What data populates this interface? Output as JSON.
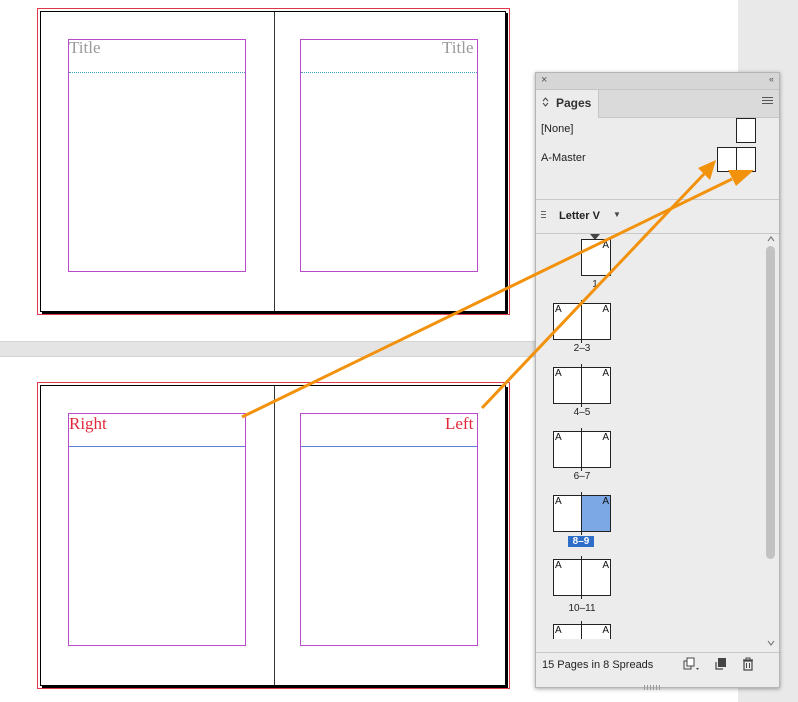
{
  "canvas": {
    "top_spread": {
      "left_title": "Title",
      "right_title": "Title"
    },
    "bottom_spread": {
      "left_label": "Right",
      "right_label": "Left"
    }
  },
  "pages_panel": {
    "close_glyph": "×",
    "collapse_glyph": "‹‹",
    "tab_label": "Pages",
    "tab_arrows": "⌃⌄",
    "masters": [
      {
        "label": "[None]"
      },
      {
        "label": "A-Master"
      }
    ],
    "page_size": "Letter V",
    "caret": "▼",
    "spreads": [
      {
        "number": "1",
        "left": "",
        "right": "A",
        "single": true,
        "selected": false
      },
      {
        "number": "2–3",
        "left": "A",
        "right": "A",
        "single": false,
        "selected": false
      },
      {
        "number": "4–5",
        "left": "A",
        "right": "A",
        "single": false,
        "selected": false
      },
      {
        "number": "6–7",
        "left": "A",
        "right": "A",
        "single": false,
        "selected": false
      },
      {
        "number": "8–9",
        "left": "A",
        "right": "A",
        "single": false,
        "selected": true
      },
      {
        "number": "10–11",
        "left": "A",
        "right": "A",
        "single": false,
        "selected": false
      },
      {
        "number": "",
        "left": "A",
        "right": "A",
        "single": false,
        "selected": false
      }
    ],
    "footer_text": "15 Pages in 8 Spreads",
    "colors": {
      "selection": "#2d6ec9",
      "selected_page_fill": "#7da8e6",
      "arrow": "#f2920c",
      "master_text": "#e0283a",
      "margin_guide": "#b84bc9"
    },
    "icons": [
      "edit-page-size-icon",
      "new-page-icon",
      "trash-icon",
      "panel-menu-icon"
    ]
  }
}
